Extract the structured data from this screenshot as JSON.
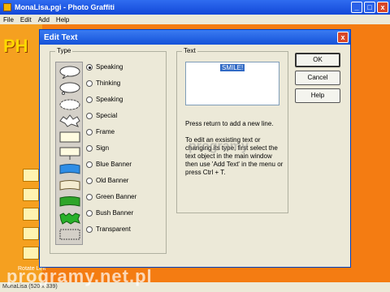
{
  "window": {
    "title": "MonaLisa.pgi - Photo Graffiti",
    "controls": {
      "minimize": "_",
      "maximize": "□",
      "close": "x"
    }
  },
  "menu": [
    "File",
    "Edit",
    "Add",
    "Help"
  ],
  "logo_text": "PH",
  "dialog": {
    "title": "Edit Text",
    "close": "x",
    "type_group": {
      "label": "Type",
      "options": [
        "Speaking",
        "Thinking",
        "Speaking",
        "Special",
        "Frame",
        "Sign",
        "Blue Banner",
        "Old Banner",
        "Green Banner",
        "Bush Banner",
        "Transparent"
      ],
      "selected_index": 0
    },
    "text_group": {
      "label": "Text",
      "value": "SMILE!",
      "hint1": "Press return to add a new line.",
      "hint2": "To edit an exsisting text or changing its type, first select the text object in the main window then use 'Add Text' in the menu or press Ctrl + T."
    },
    "buttons": {
      "ok": "OK",
      "cancel": "Cancel",
      "help": "Help"
    }
  },
  "rotate_label": "Rotate Left",
  "status": "MonaLisa (520 x 339)",
  "watermarks": {
    "bottom": "programy.net.pl",
    "center": "programy"
  },
  "colors": {
    "accent": "#1552d8",
    "workspace": "#f47c12"
  }
}
